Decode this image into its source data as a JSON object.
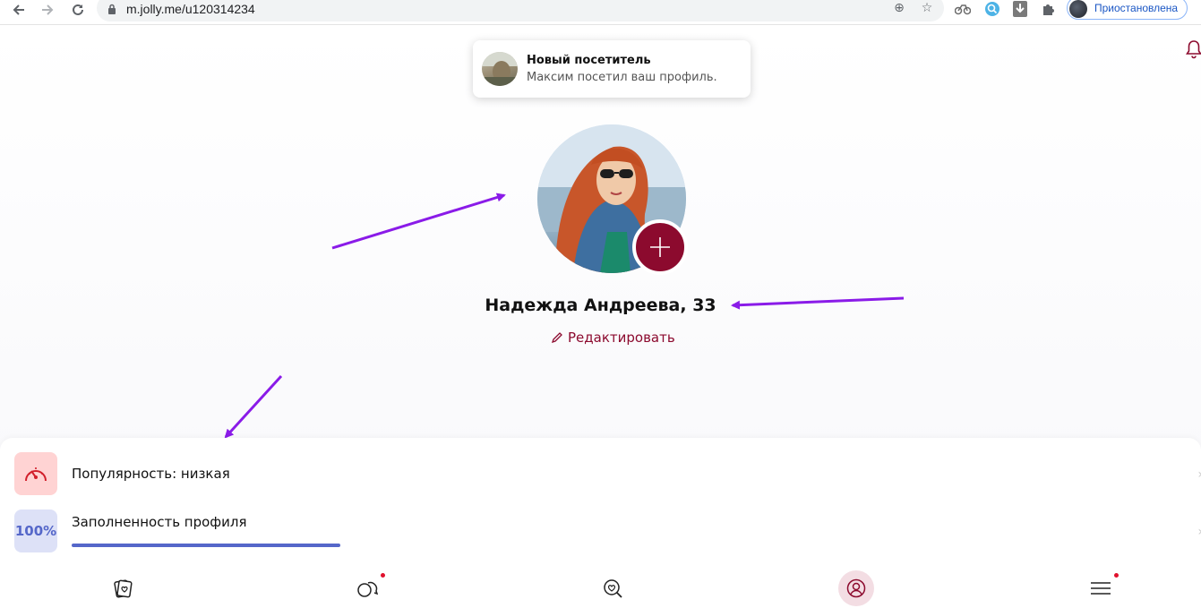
{
  "browser": {
    "url": "m.jolly.me/u120314234",
    "profile_status": "Приостановлена"
  },
  "notification": {
    "title": "Новый посетитель",
    "text": "Максим посетил ваш профиль."
  },
  "profile": {
    "name": "Надежда Андреева, 33",
    "edit_label": "Редактировать"
  },
  "stats": [
    {
      "label": "Популярность: низкая",
      "icon": "speedometer-icon"
    },
    {
      "label": "Заполненность профиля",
      "badge": "100%",
      "progress_percent": 100
    }
  ],
  "tabbar": [
    {
      "icon": "cards-icon",
      "badge": false
    },
    {
      "icon": "chat-icon",
      "badge": true
    },
    {
      "icon": "search-heart-icon",
      "badge": false
    },
    {
      "icon": "profile-icon",
      "badge": false,
      "active": true
    },
    {
      "icon": "menu-icon",
      "badge": true
    }
  ],
  "colors": {
    "accent": "#8c0a2e",
    "arrow": "#8a1be8",
    "progress": "#5567c9"
  }
}
